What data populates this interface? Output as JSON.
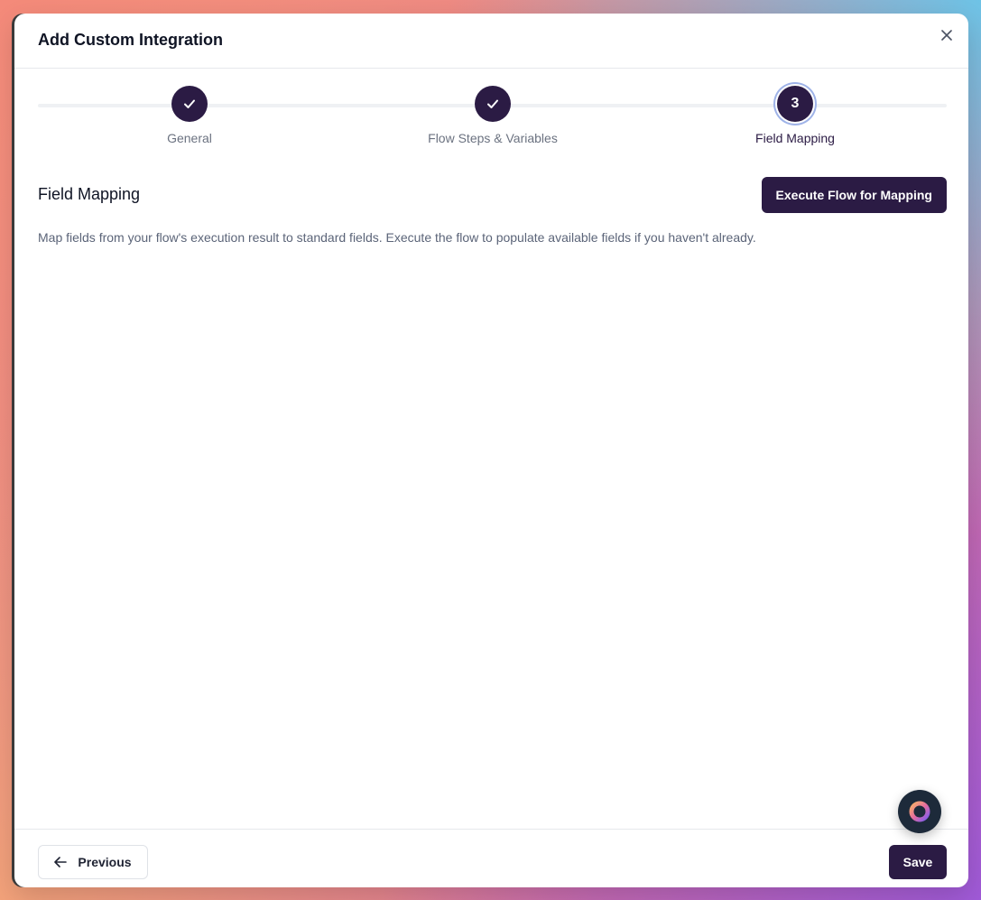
{
  "modal": {
    "title": "Add Custom Integration"
  },
  "stepper": {
    "steps": [
      {
        "label": "General",
        "status": "completed"
      },
      {
        "label": "Flow Steps & Variables",
        "status": "completed"
      },
      {
        "label": "Field Mapping",
        "status": "active",
        "number": "3"
      }
    ]
  },
  "section": {
    "title": "Field Mapping",
    "execute_button": "Execute Flow for Mapping",
    "description": "Map fields from your flow's execution result to standard fields. Execute the flow to populate available fields if you haven't already."
  },
  "footer": {
    "previous_label": "Previous",
    "save_label": "Save"
  },
  "colors": {
    "primary": "#2b1b44",
    "active_ring": "#9fb3e8",
    "muted_text": "#6b7280"
  },
  "icons": {
    "close": "close-icon",
    "check": "check-icon",
    "arrow_left": "arrow-left-icon",
    "assistant": "assistant-ring-icon"
  }
}
